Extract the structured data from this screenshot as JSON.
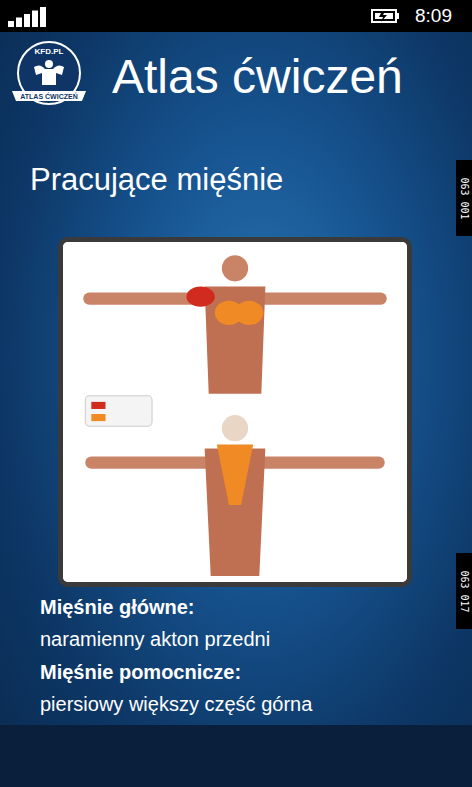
{
  "status_bar": {
    "time": "8:09",
    "signal": {
      "level": 1
    }
  },
  "header": {
    "logo": {
      "top": "KFD.PL",
      "bottom": "ATLAS ĆWICZEŃ"
    },
    "title": "Atlas ćwiczeń"
  },
  "section_title": "Pracujące mięśnie",
  "side_tabs": [
    {
      "label": "063 001"
    },
    {
      "label": "063 017"
    }
  ],
  "muscles": [
    {
      "heading": "Mięśnie główne:",
      "value": "naramienny akton przedni"
    },
    {
      "heading": "Mięśnie pomocnicze:",
      "value": "piersiowy większy część górna"
    }
  ]
}
